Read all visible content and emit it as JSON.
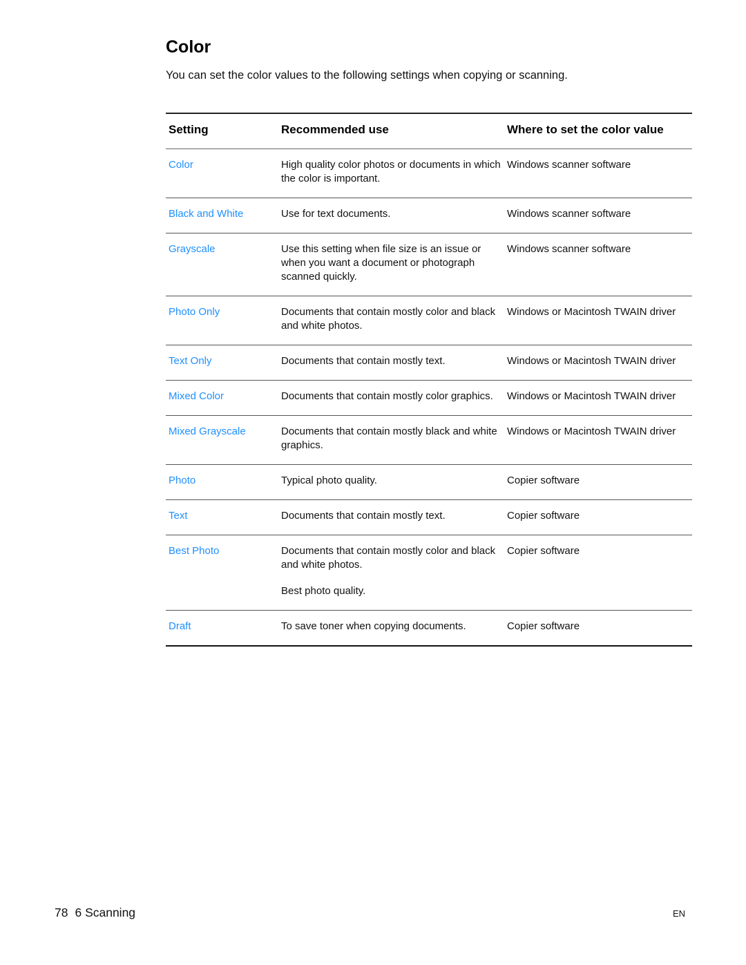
{
  "page": {
    "title": "Color",
    "intro": "You can set the color values to the following settings when copying or scanning.",
    "link_color": "#1e8fff"
  },
  "table": {
    "headers": [
      "Setting",
      "Recommended use",
      "Where to set the color value"
    ],
    "rows": [
      {
        "setting": "Color",
        "use": [
          "High quality color photos or documents in which the color is important."
        ],
        "where": "Windows scanner software"
      },
      {
        "setting": "Black and White",
        "use": [
          "Use for text documents."
        ],
        "where": "Windows scanner software"
      },
      {
        "setting": "Grayscale",
        "use": [
          "Use this setting when file size is an issue or when you want a document or photograph scanned quickly."
        ],
        "where": "Windows scanner software"
      },
      {
        "setting": "Photo Only",
        "use": [
          "Documents that contain mostly color and black and white photos."
        ],
        "where": "Windows or Macintosh TWAIN driver"
      },
      {
        "setting": "Text Only",
        "use": [
          "Documents that contain mostly text."
        ],
        "where": "Windows or Macintosh TWAIN driver"
      },
      {
        "setting": "Mixed Color",
        "use": [
          "Documents that contain mostly color graphics."
        ],
        "where": "Windows or Macintosh TWAIN driver"
      },
      {
        "setting": "Mixed Grayscale",
        "use": [
          "Documents that contain mostly black and white graphics."
        ],
        "where": "Windows or Macintosh TWAIN driver"
      },
      {
        "setting": "Photo",
        "use": [
          "Typical photo quality."
        ],
        "where": "Copier software"
      },
      {
        "setting": "Text",
        "use": [
          "Documents that contain mostly text."
        ],
        "where": "Copier software"
      },
      {
        "setting": "Best Photo",
        "use": [
          "Documents that contain mostly color and black and white photos.",
          "Best photo quality."
        ],
        "where": "Copier software"
      },
      {
        "setting": "Draft",
        "use": [
          "To save toner when copying documents."
        ],
        "where": "Copier software"
      }
    ]
  },
  "footer": {
    "page_number": "78",
    "chapter": "6 Scanning",
    "language": "EN"
  }
}
